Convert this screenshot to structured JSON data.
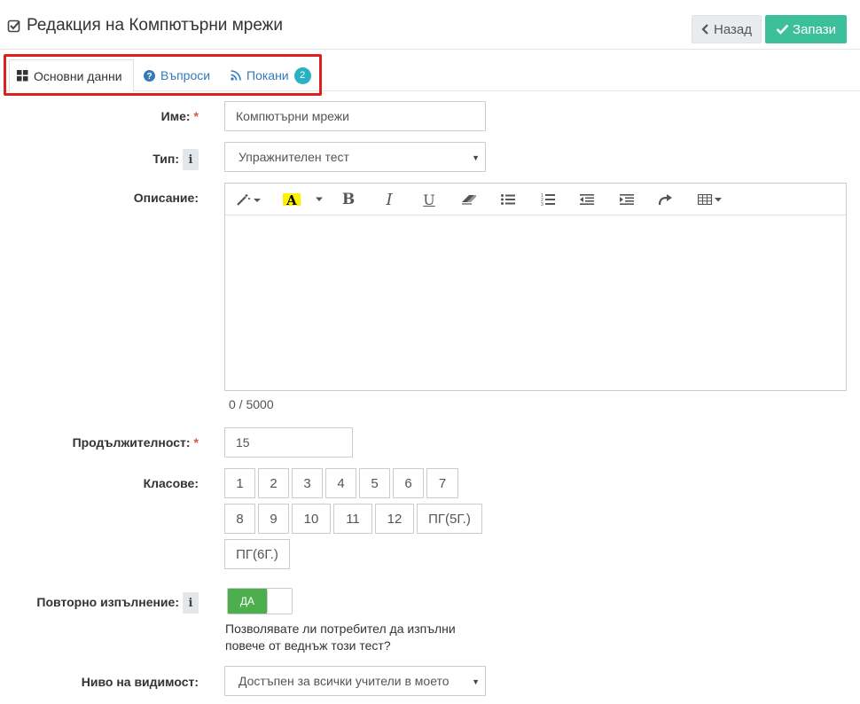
{
  "header": {
    "title": "Редакция на Компютърни мрежи",
    "back_label": "Назад",
    "save_label": "Запази"
  },
  "tabs": [
    {
      "label": "Основни данни",
      "icon": "grid-icon",
      "active": true
    },
    {
      "label": "Въпроси",
      "icon": "question-circle-icon",
      "active": false
    },
    {
      "label": "Покани",
      "icon": "rss-icon",
      "active": false,
      "badge": "2"
    }
  ],
  "form": {
    "name": {
      "label": "Име:",
      "required": "*",
      "value": "Компютърни мрежи"
    },
    "type": {
      "label": "Тип:",
      "value": "Упражнителен тест"
    },
    "description": {
      "label": "Описание:",
      "value": "",
      "counter": "0 / 5000",
      "toolbar": [
        "magic-wand-icon",
        "font-color-icon",
        "bold-icon",
        "italic-icon",
        "underline-icon",
        "eraser-icon",
        "bullet-list-icon",
        "numbered-list-icon",
        "outdent-icon",
        "indent-icon",
        "redo-icon",
        "table-icon"
      ]
    },
    "duration": {
      "label": "Продължителност:",
      "required": "*",
      "value": "15"
    },
    "grades": {
      "label": "Класове:",
      "options": [
        "1",
        "2",
        "3",
        "4",
        "5",
        "6",
        "7",
        "8",
        "9",
        "10",
        "11",
        "12",
        "ПГ(5Г.)",
        "ПГ(6Г.)"
      ]
    },
    "repeat": {
      "label": "Повторно изпълнение:",
      "toggle_label": "ДА",
      "enabled": true,
      "help_line1": "Позволявате ли потребител да изпълни",
      "help_line2": "повече от веднъж този тест?"
    },
    "visibility": {
      "label": "Ниво на видимост:",
      "value": "Достъпен за всички учители в моето"
    }
  },
  "colors": {
    "accent": "#3cbf9b",
    "highlight_border": "#e02020",
    "badge": "#27b3c4",
    "toggle_on": "#4cae4c",
    "link": "#337ab7"
  }
}
